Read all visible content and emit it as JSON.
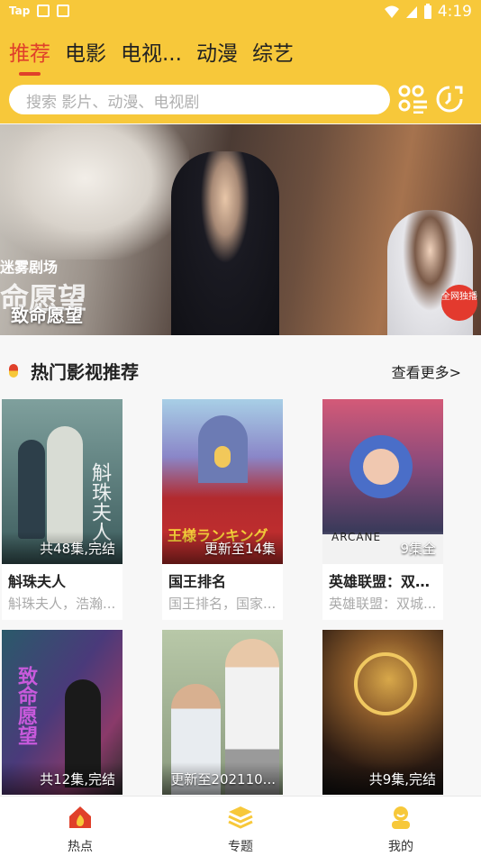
{
  "status_bar": {
    "left_text": "Tap",
    "time": "4:19"
  },
  "top_tabs": [
    {
      "label": "推荐",
      "active": true
    },
    {
      "label": "电影",
      "active": false
    },
    {
      "label": "电视...",
      "active": false
    },
    {
      "label": "动漫",
      "active": false
    },
    {
      "label": "综艺",
      "active": false
    }
  ],
  "search": {
    "placeholder": "搜索 影片、动漫、电视剧"
  },
  "banner": {
    "title": "致命愿望",
    "poster_line1": "迷雾剧场",
    "poster_line2": "命愿望",
    "poster_badge": "全网独播"
  },
  "section": {
    "title": "热门影视推荐",
    "more": "查看更多>"
  },
  "cards": [
    {
      "name": "斛珠夫人",
      "desc": "斛珠夫人，浩瀚...",
      "status": "共48集,完结",
      "poster_text": "斛珠夫人",
      "color_top": "#6e8a88",
      "color_bottom": "#2a4a4c"
    },
    {
      "name": "国王排名",
      "desc": "国王排名，国家...",
      "status": "更新至14集",
      "poster_text": "王様ランキング",
      "color_top": "#8ab8d8",
      "color_bottom": "#b4282c"
    },
    {
      "name": "英雄联盟：双城...",
      "desc": "英雄联盟：双城...",
      "status": "9集全",
      "poster_text": "ARCANE",
      "color_top": "#c0506a",
      "color_bottom": "#3a3a5a"
    },
    {
      "name": "",
      "desc": "",
      "status": "共12集,完结",
      "poster_text": "致命愿望",
      "color_top": "#3a5a6a",
      "color_bottom": "#7a3a5a"
    },
    {
      "name": "",
      "desc": "",
      "status": "更新至202110...",
      "poster_text": "",
      "color_top": "#9aa88e",
      "color_bottom": "#6a6a6a"
    },
    {
      "name": "",
      "desc": "",
      "status": "共9集,完结",
      "poster_text": "",
      "color_top": "#5a3a1a",
      "color_bottom": "#1a1a1a"
    }
  ],
  "bottom_tabs": [
    {
      "label": "热点",
      "icon": "home-fire-icon",
      "active": true
    },
    {
      "label": "专题",
      "icon": "layers-icon",
      "active": false
    },
    {
      "label": "我的",
      "icon": "user-icon",
      "active": false
    }
  ],
  "colors": {
    "header_bg": "#f7c83a",
    "accent": "#e0402a"
  }
}
